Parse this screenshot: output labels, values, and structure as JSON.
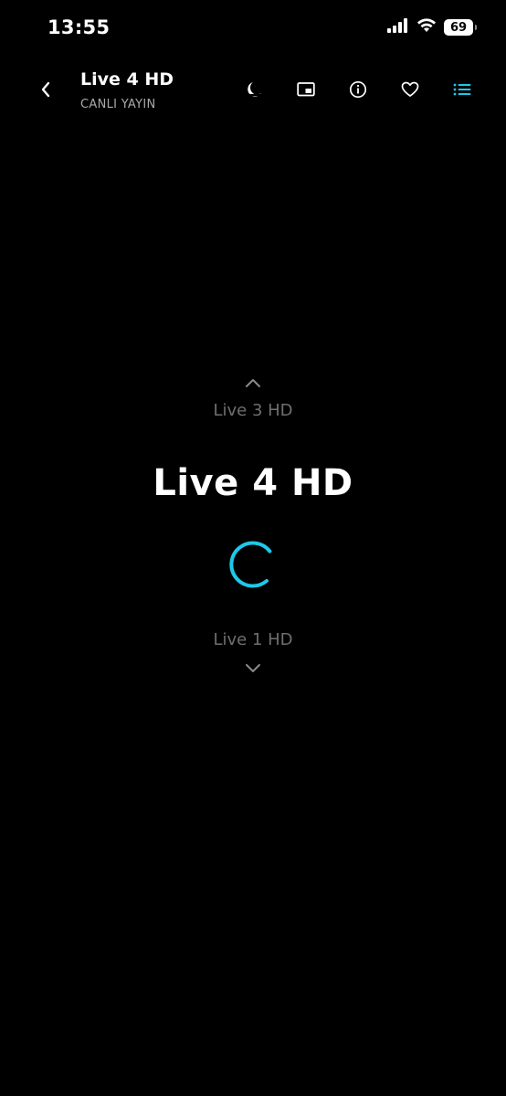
{
  "status_bar": {
    "time": "13:55",
    "battery": "69",
    "icons": [
      "signal-icon",
      "wifi-icon",
      "battery-icon"
    ]
  },
  "header": {
    "back_icon": "chevron-left-icon",
    "title": "Live 4 HD",
    "subtitle": "CANLI YAYIN",
    "actions": [
      {
        "icon": "sleep-timer-icon"
      },
      {
        "icon": "picture-in-picture-icon"
      },
      {
        "icon": "info-icon"
      },
      {
        "icon": "favorite-heart-icon"
      },
      {
        "icon": "channel-list-icon",
        "active": true
      }
    ]
  },
  "switcher": {
    "previous_channel": "Live 3 HD",
    "current_channel": "Live 4 HD",
    "next_channel": "Live 1 HD"
  },
  "colors": {
    "background": "#000000",
    "accent": "#1fc8e8",
    "muted_text": "#6f6f6f",
    "subtitle_text": "#a9a9a9"
  }
}
